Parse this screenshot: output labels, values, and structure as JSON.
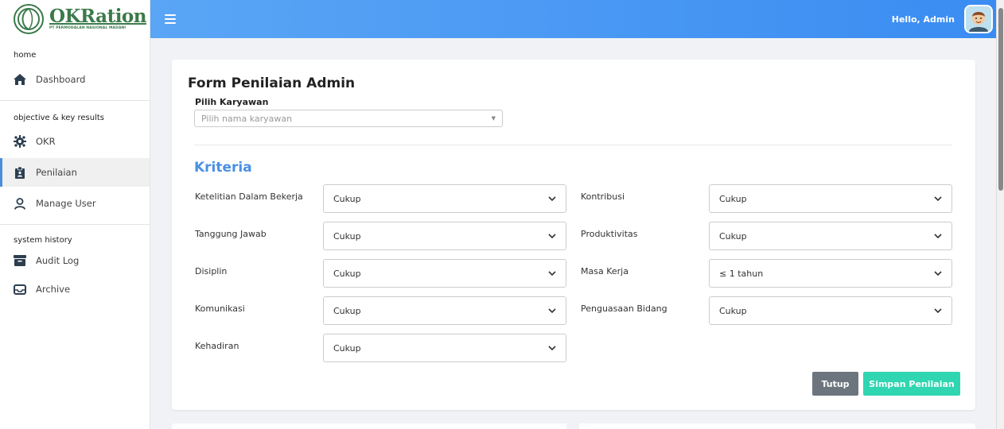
{
  "brand": {
    "title": "OKRation",
    "subtitle": "PT PERMODALAN NASIONAL MADANI"
  },
  "header": {
    "greeting": "Hello, Admin"
  },
  "sidebar": {
    "groups": [
      {
        "label": "home"
      },
      {
        "label": "objective & key results"
      },
      {
        "label": "system history"
      }
    ],
    "items": [
      {
        "label": "Dashboard"
      },
      {
        "label": "OKR"
      },
      {
        "label": "Penilaian"
      },
      {
        "label": "Manage User"
      },
      {
        "label": "Audit Log"
      },
      {
        "label": "Archive"
      }
    ]
  },
  "form": {
    "title": "Form Penilaian Admin",
    "employee_label": "Pilih Karyawan",
    "employee_placeholder": "Pilih nama karyawan",
    "section_title": "Kriteria",
    "criteria_left": [
      {
        "label": "Ketelitian Dalam Bekerja",
        "value": "Cukup"
      },
      {
        "label": "Tanggung Jawab",
        "value": "Cukup"
      },
      {
        "label": "Disiplin",
        "value": "Cukup"
      },
      {
        "label": "Komunikasi",
        "value": "Cukup"
      },
      {
        "label": "Kehadiran",
        "value": "Cukup"
      }
    ],
    "criteria_right": [
      {
        "label": "Kontribusi",
        "value": "Cukup"
      },
      {
        "label": "Produktivitas",
        "value": "Cukup"
      },
      {
        "label": "Masa Kerja",
        "value": "≤ 1 tahun"
      },
      {
        "label": "Penguasaan Bidang",
        "value": "Cukup"
      }
    ],
    "close_label": "Tutup",
    "save_label": "Simpan Penilaian"
  },
  "colors": {
    "header_gradient_start": "#5aa5f5",
    "header_gradient_end": "#3a8cf2",
    "accent": "#4a90e2",
    "save_button": "#2fd6b1",
    "close_button": "#6c757d",
    "brand_green": "#3b7a4a"
  },
  "icons": {
    "menu": "hamburger-icon",
    "dashboard": "home-icon",
    "okr": "gear-icon",
    "penilaian": "clipboard-icon",
    "manage_user": "user-icon",
    "audit_log": "archive-box-icon",
    "archive": "inbox-icon"
  }
}
